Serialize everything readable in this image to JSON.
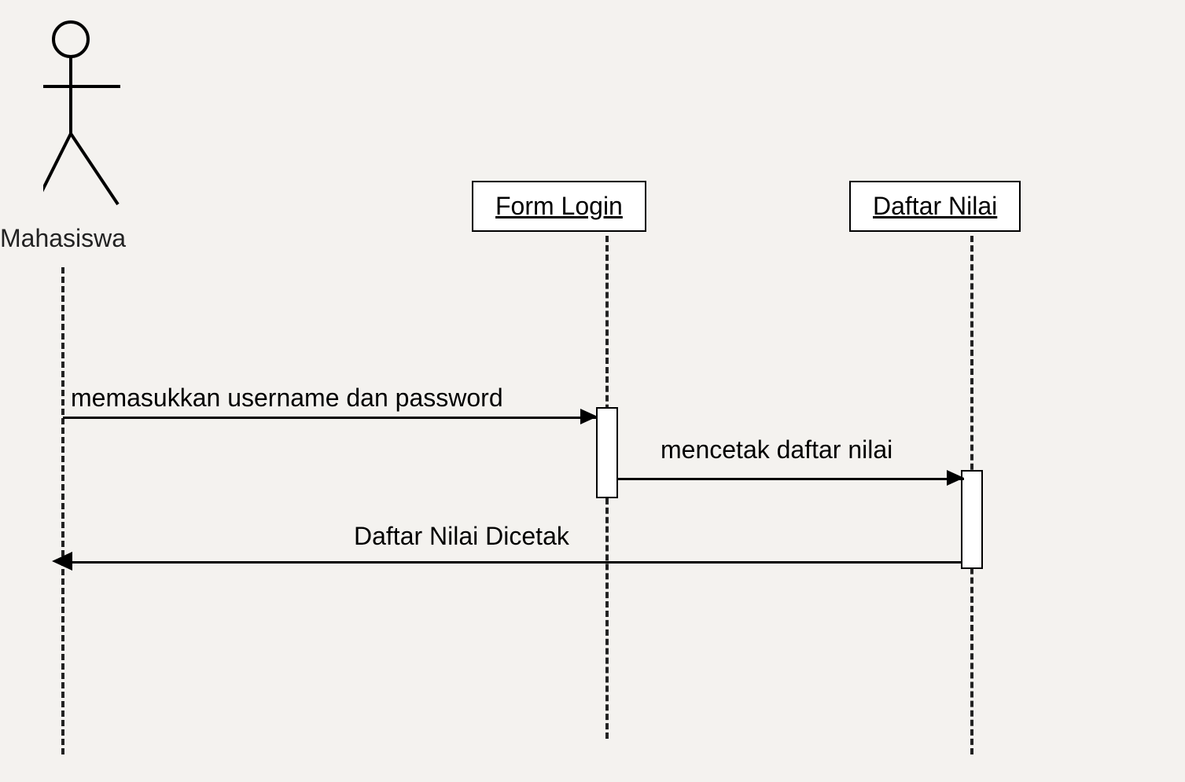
{
  "diagram": {
    "type": "sequence",
    "actor": {
      "label": "Mahasiswa"
    },
    "objects": [
      {
        "label": "Form Login"
      },
      {
        "label": "Daftar Nilai"
      }
    ],
    "messages": [
      {
        "label": "memasukkan username dan password"
      },
      {
        "label": "mencetak daftar nilai"
      },
      {
        "label": "Daftar Nilai Dicetak"
      }
    ]
  }
}
